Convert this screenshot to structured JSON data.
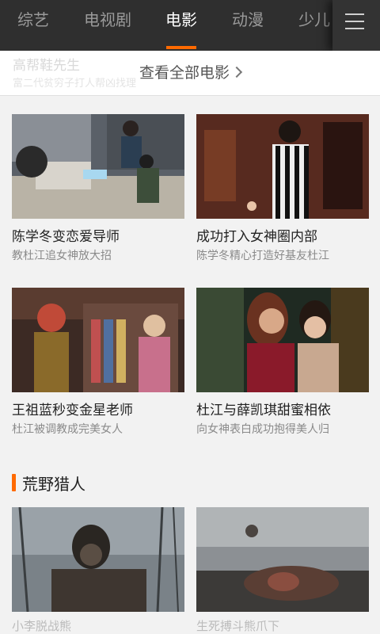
{
  "tabs": [
    {
      "label": "综艺",
      "active": false
    },
    {
      "label": "电视剧",
      "active": false
    },
    {
      "label": "电影",
      "active": true
    },
    {
      "label": "动漫",
      "active": false
    },
    {
      "label": "少儿",
      "active": false
    }
  ],
  "faded_previous": {
    "title": "高帮鞋先生",
    "subtitle": "富二代贫穷子打人帮凶找理"
  },
  "view_all": {
    "label": "查看全部电影"
  },
  "cards": [
    {
      "title": "陈学冬变恋爱导师",
      "subtitle": "教杜江追女神放大招"
    },
    {
      "title": "成功打入女神圈内部",
      "subtitle": "陈学冬精心打造好基友杜江"
    },
    {
      "title": "王祖蓝秒变金星老师",
      "subtitle": "杜江被调教成完美女人"
    },
    {
      "title": "杜江与薛凯琪甜蜜相依",
      "subtitle": "向女神表白成功抱得美人归"
    }
  ],
  "section": {
    "title": "荒野猎人"
  },
  "bottom_cards": [
    {
      "title": "小李脱战熊"
    },
    {
      "title": "生死搏斗熊爪下"
    }
  ],
  "colors": {
    "accent": "#ff6a00",
    "tabbar_bg": "#2f2f2f",
    "tab_inactive": "#9a9a9a",
    "tab_active": "#ffffff",
    "page_bg": "#f2f2f2"
  },
  "icons": {
    "menu": "hamburger-menu-icon",
    "view_all_arrow": "chevron-right-icon"
  }
}
